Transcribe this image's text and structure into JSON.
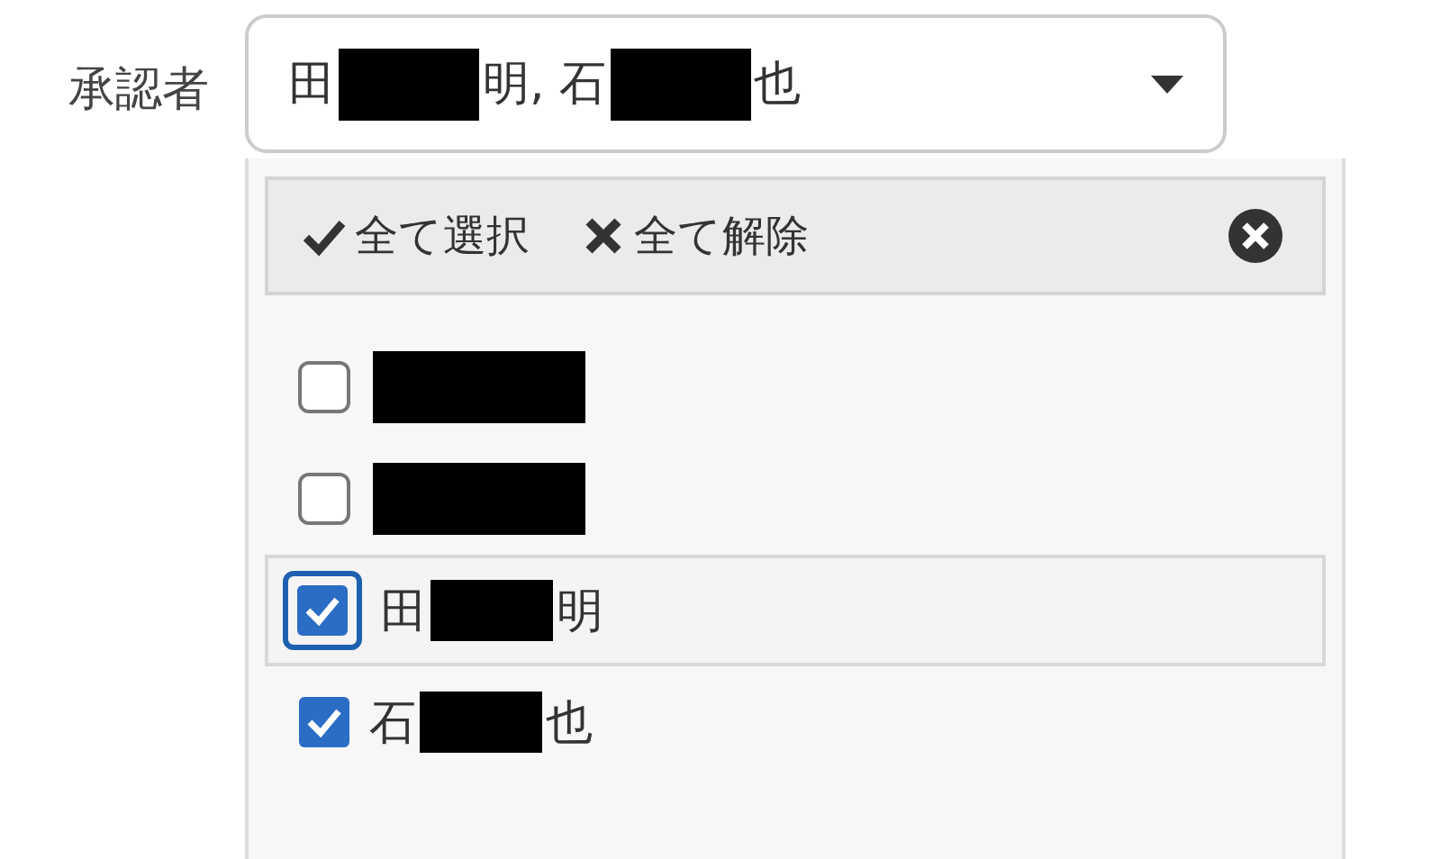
{
  "field": {
    "label": "承認者",
    "value": [
      {
        "kind": "text",
        "text": "田"
      },
      {
        "kind": "redacted"
      },
      {
        "kind": "text",
        "text": "明, 石"
      },
      {
        "kind": "redacted"
      },
      {
        "kind": "text",
        "text": "也"
      }
    ]
  },
  "dropdown": {
    "actions": [
      {
        "kind": "check",
        "label": "全て選択"
      },
      {
        "kind": "cross",
        "label": "全て解除"
      }
    ],
    "items": [
      {
        "checked": false,
        "focused": false,
        "name": [
          {
            "kind": "redacted"
          }
        ]
      },
      {
        "checked": false,
        "focused": false,
        "name": [
          {
            "kind": "redacted"
          }
        ]
      },
      {
        "checked": true,
        "focused": true,
        "name": [
          {
            "kind": "text",
            "text": "田"
          },
          {
            "kind": "redacted"
          },
          {
            "kind": "text",
            "text": "明"
          }
        ]
      },
      {
        "checked": true,
        "focused": false,
        "name": [
          {
            "kind": "text",
            "text": "石"
          },
          {
            "kind": "redacted"
          },
          {
            "kind": "text",
            "text": "也"
          }
        ]
      }
    ]
  }
}
